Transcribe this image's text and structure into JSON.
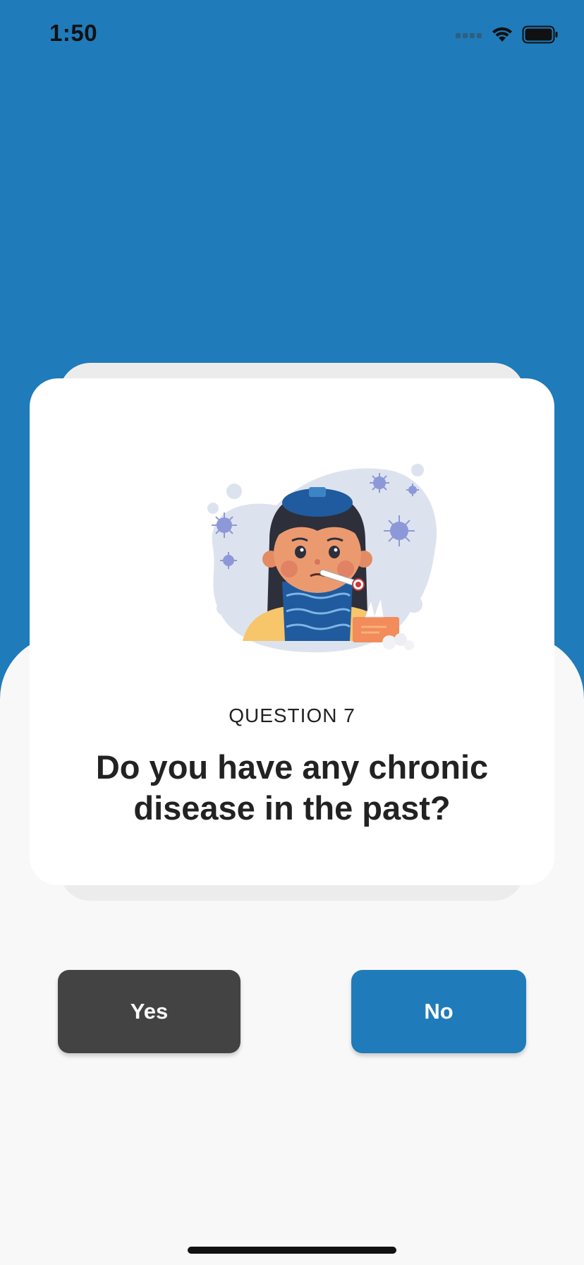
{
  "status_bar": {
    "time": "1:50"
  },
  "question": {
    "label": "QUESTION 7",
    "text": "Do you have any chronic disease in the past?"
  },
  "illustration": {
    "icon": "sick-person-illustration"
  },
  "answers": {
    "yes_label": "Yes",
    "no_label": "No"
  },
  "colors": {
    "primary": "#1f7bba",
    "yes_button": "#434343",
    "card": "#ffffff",
    "background": "#f8f8f8"
  }
}
